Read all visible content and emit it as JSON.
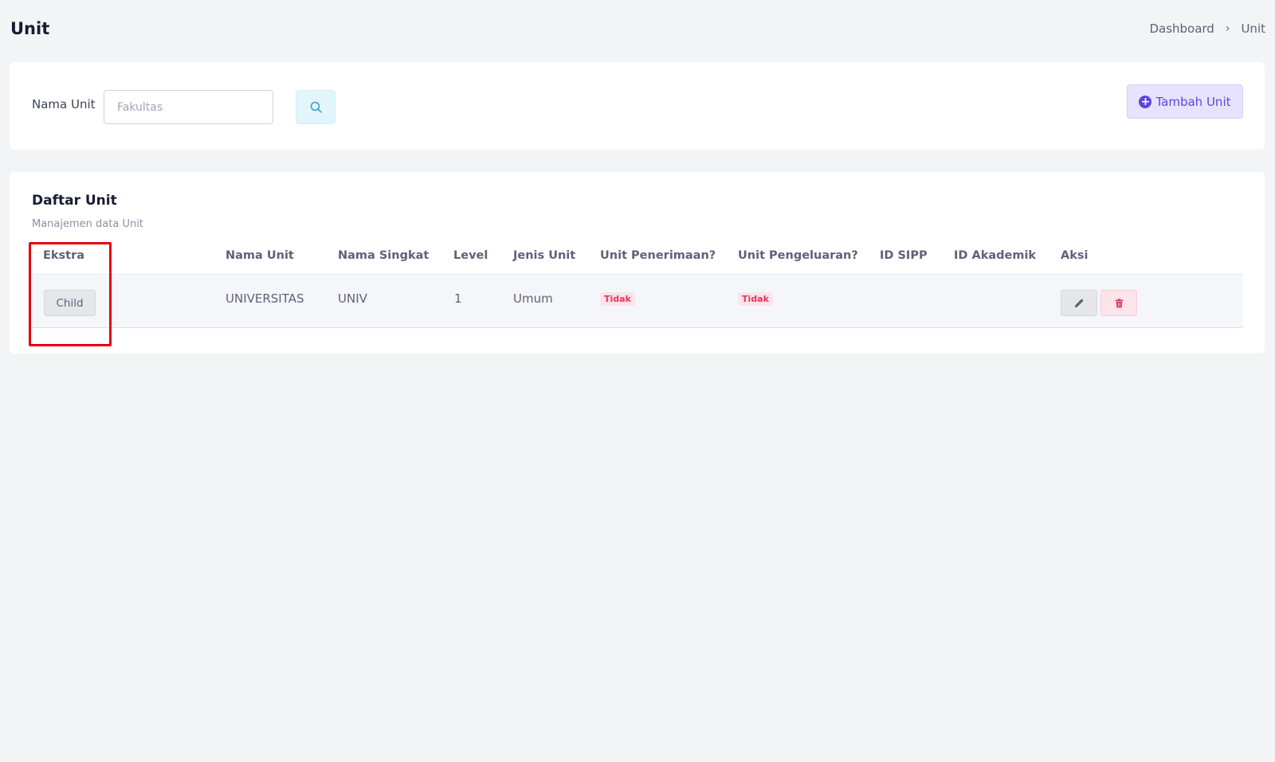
{
  "header": {
    "title": "Unit",
    "breadcrumb": {
      "home": "Dashboard",
      "separator": "›",
      "current": "Unit"
    }
  },
  "filter": {
    "label": "Nama Unit",
    "input_value": "",
    "input_placeholder": "Fakultas",
    "search_icon": "search-icon",
    "add_button_label": "Tambah Unit",
    "add_icon": "plus-circle-icon"
  },
  "list": {
    "title": "Daftar Unit",
    "subtitle": "Manajemen data Unit",
    "columns": [
      "Ekstra",
      "Nama Unit",
      "Nama Singkat",
      "Level",
      "Jenis Unit",
      "Unit Penerimaan?",
      "Unit Pengeluaran?",
      "ID SIPP",
      "ID Akademik",
      "Aksi"
    ],
    "rows": [
      {
        "ekstra_button": "Child",
        "nama_unit": "UNIVERSITAS",
        "nama_singkat": "UNIV",
        "level": "1",
        "jenis_unit": "Umum",
        "unit_penerimaan": "Tidak",
        "unit_pengeluaran": "Tidak",
        "id_sipp": "",
        "id_akademik": "",
        "actions": [
          "pencil-icon",
          "trash-icon"
        ]
      }
    ]
  },
  "colors": {
    "page_bg": "#f3f4f6",
    "accent_primary": "#5b48d8",
    "badge_danger_text": "#e8335a",
    "badge_danger_bg": "#fde3ea",
    "highlight": "#e8000b"
  }
}
